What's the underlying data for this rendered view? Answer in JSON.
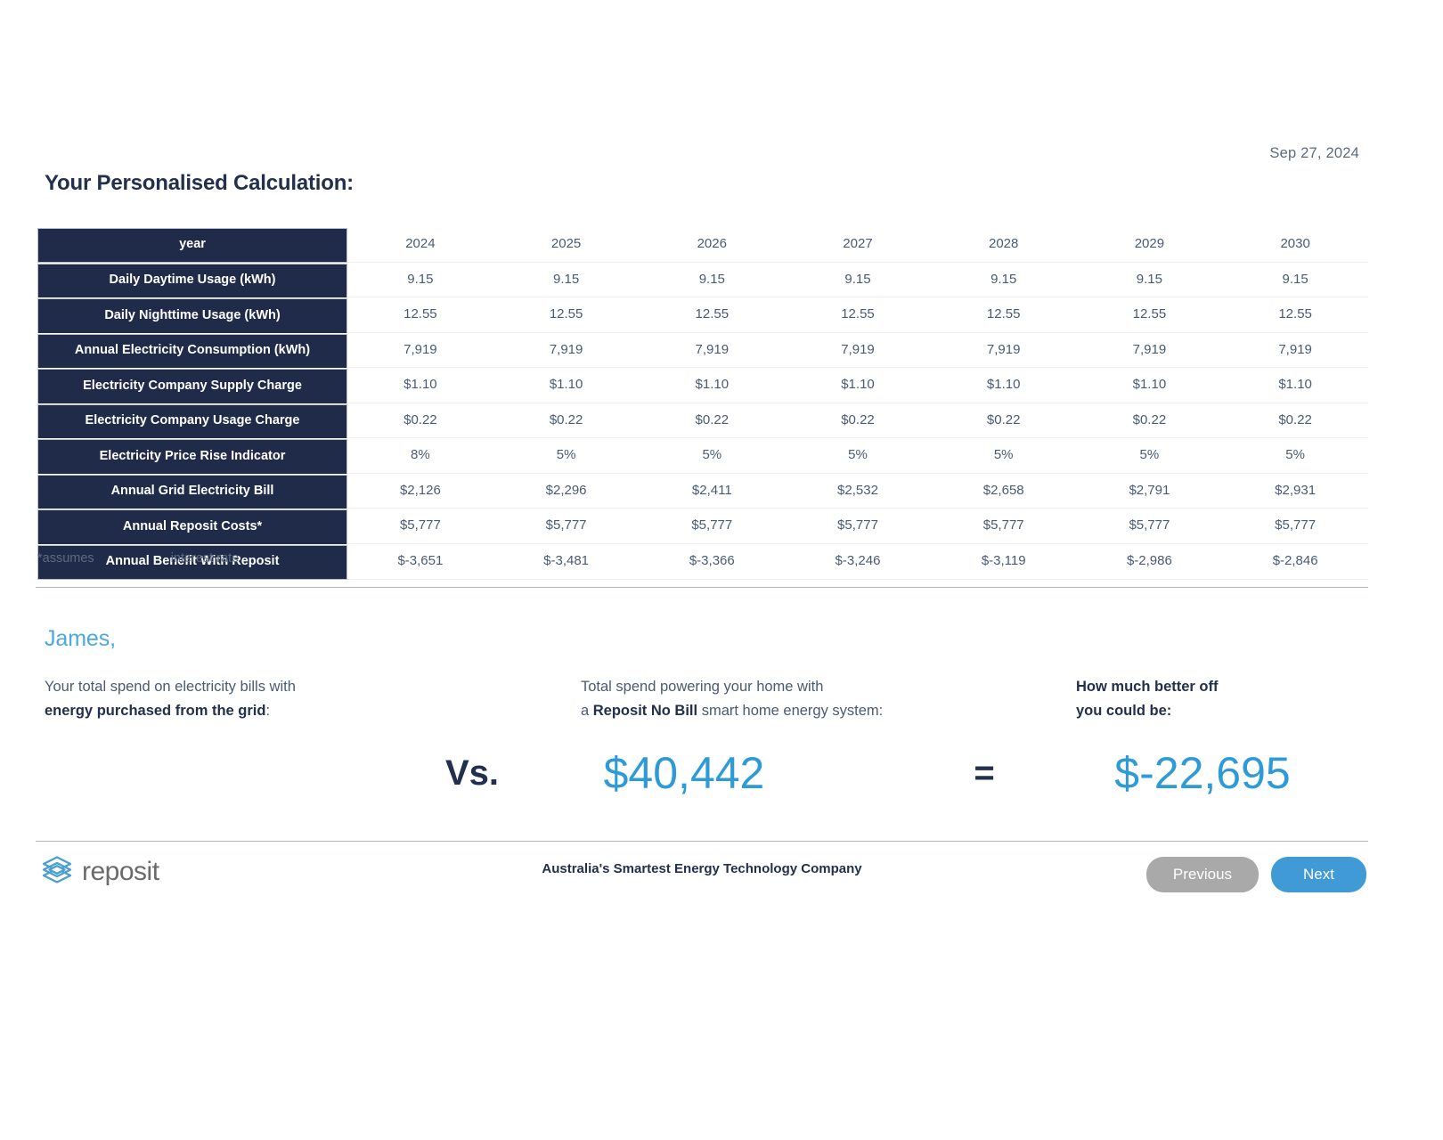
{
  "header": {
    "date": "Sep 27, 2024",
    "title": "Your Personalised Calculation:"
  },
  "table": {
    "row_label_header": "year",
    "years": [
      "2024",
      "2025",
      "2026",
      "2027",
      "2028",
      "2029",
      "2030"
    ],
    "rows": [
      {
        "label": "Daily Daytime Usage (kWh)",
        "values": [
          "9.15",
          "9.15",
          "9.15",
          "9.15",
          "9.15",
          "9.15",
          "9.15"
        ]
      },
      {
        "label": "Daily Nighttime Usage (kWh)",
        "values": [
          "12.55",
          "12.55",
          "12.55",
          "12.55",
          "12.55",
          "12.55",
          "12.55"
        ]
      },
      {
        "label": "Annual Electricity Consumption (kWh)",
        "values": [
          "7,919",
          "7,919",
          "7,919",
          "7,919",
          "7,919",
          "7,919",
          "7,919"
        ]
      },
      {
        "label": "Electricity Company Supply Charge",
        "values": [
          "$1.10",
          "$1.10",
          "$1.10",
          "$1.10",
          "$1.10",
          "$1.10",
          "$1.10"
        ]
      },
      {
        "label": "Electricity Company Usage Charge",
        "values": [
          "$0.22",
          "$0.22",
          "$0.22",
          "$0.22",
          "$0.22",
          "$0.22",
          "$0.22"
        ]
      },
      {
        "label": "Electricity Price Rise Indicator",
        "values": [
          "8%",
          "5%",
          "5%",
          "5%",
          "5%",
          "5%",
          "5%"
        ]
      },
      {
        "label": "Annual Grid Electricity Bill",
        "values": [
          "$2,126",
          "$2,296",
          "$2,411",
          "$2,532",
          "$2,658",
          "$2,791",
          "$2,931"
        ]
      },
      {
        "label": "Annual Reposit Costs*",
        "values": [
          "$5,777",
          "$5,777",
          "$5,777",
          "$5,777",
          "$5,777",
          "$5,777",
          "$5,777"
        ]
      },
      {
        "label": "Annual Benefit With Reposit",
        "values": [
          "$-3,651",
          "$-3,481",
          "$-3,366",
          "$-3,246",
          "$-3,119",
          "$-2,986",
          "$-2,846"
        ]
      }
    ]
  },
  "footnote": {
    "prefix": "*assumes",
    "suffix": "interest rate"
  },
  "summary": {
    "greeting": "James,",
    "grid": {
      "line1": "Your total spend on electricity bills with",
      "line2_bold": "energy purchased from the grid",
      "line2_tail": ":",
      "value": ""
    },
    "reposit": {
      "line1": "Total spend powering your home with",
      "line2_prefix": "a ",
      "line2_bold": "Reposit No Bill",
      "line2_tail": " smart home energy system:",
      "value": "$40,442"
    },
    "benefit": {
      "line1": "How much better off",
      "line2": "you could be:",
      "value": "$-22,695"
    },
    "operator_vs": "Vs.",
    "operator_eq": "="
  },
  "footer": {
    "brand_name": "reposit",
    "tagline": "Australia's Smartest Energy Technology Company",
    "previous_label": "Previous",
    "next_label": "Next",
    "accent_color": "#3f9ad6",
    "prev_color": "#a9a9a9"
  }
}
